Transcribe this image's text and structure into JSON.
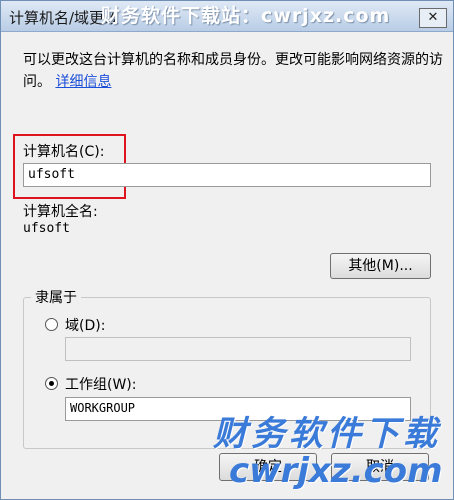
{
  "window": {
    "title": "计算机名/域更改",
    "close_label": "✕"
  },
  "watermark": {
    "top": "财务软件下载站：cwrjxz.com",
    "big": "财务软件下载",
    "url": "cwrjxz.com"
  },
  "description": {
    "text": "可以更改这台计算机的名称和成员身份。更改可能影响网络资源的访问。",
    "link": "详细信息"
  },
  "computer_name": {
    "label": "计算机名(C):",
    "value": "ufsoft"
  },
  "full_name": {
    "label": "计算机全名:",
    "value": "ufsoft"
  },
  "other_button": "其他(M)...",
  "member_of": {
    "title": "隶属于",
    "domain_label": "域(D):",
    "domain_value": "",
    "workgroup_label": "工作组(W):",
    "workgroup_value": "WORKGROUP"
  },
  "buttons": {
    "ok": "确定",
    "cancel": "取消"
  },
  "colors": {
    "highlight_box": "#e0141e",
    "link": "#1a4fd8",
    "watermark": "#3a7ad8"
  }
}
